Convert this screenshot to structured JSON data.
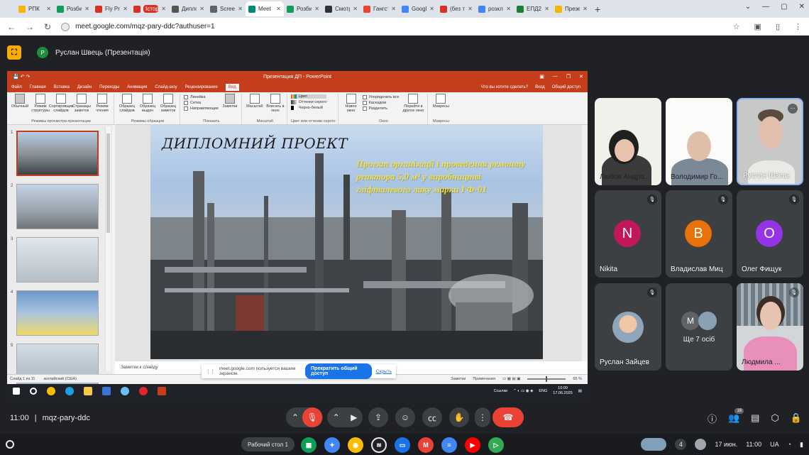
{
  "browser": {
    "tabs": [
      {
        "label": "РПК",
        "color": "#f4b400",
        "pill": false
      },
      {
        "label": "Розбив",
        "color": "#0f9d58"
      },
      {
        "label": "Fly Proje",
        "color": "#d93025"
      },
      {
        "label": "Історія",
        "color": "#d93025",
        "pill": true
      },
      {
        "label": "Диплом",
        "color": "#555555"
      },
      {
        "label": "Screensh",
        "color": "#5f6368"
      },
      {
        "label": "Meet",
        "color": "#00897b",
        "active": true
      },
      {
        "label": "Розбив",
        "color": "#0f9d58"
      },
      {
        "label": "Смотрет",
        "color": "#333333"
      },
      {
        "label": "Гангстер",
        "color": "#ea4335"
      },
      {
        "label": "Google G",
        "color": "#4285f4"
      },
      {
        "label": "(без тем",
        "color": "#d93025"
      },
      {
        "label": "розклад",
        "color": "#4285f4"
      },
      {
        "label": "ЕПД23 н",
        "color": "#188038"
      },
      {
        "label": "Презент",
        "color": "#f4b400"
      }
    ],
    "url": "meet.google.com/mqz-pary-ddc?authuser=1"
  },
  "meet": {
    "presenter_initial": "P",
    "presenter_title": "Руслан Швець (Презентація)",
    "meeting_time": "11:00",
    "meeting_code": "mqz-pary-ddc",
    "participant_count_badge": "16"
  },
  "ppt": {
    "window_title": "Презентация ДП - PowerPoint",
    "ribbon_tabs": [
      "Файл",
      "Главная",
      "Вставка",
      "Дизайн",
      "Переходы",
      "Анимация",
      "Слайд-шоу",
      "Рецензирование",
      "Вид"
    ],
    "tell_me": "Что вы хотите сделать?",
    "signin": "Вход",
    "share": "Общий доступ",
    "groups": {
      "views": {
        "label": "Режимы просмотра презентации",
        "buttons": [
          "Обычный",
          "Режим структуры",
          "Сортировщик слайдов",
          "Страницы заметок",
          "Режим чтения"
        ]
      },
      "masters": {
        "label": "Режимы образцов",
        "buttons": [
          "Образец слайдов",
          "Образец выдач",
          "Образец заметок"
        ]
      },
      "show": {
        "label": "Показать",
        "checks": [
          "Линейка",
          "Сетка",
          "Направляющие"
        ],
        "notes_button": "Заметки"
      },
      "zoom": {
        "label": "Масштаб",
        "buttons": [
          "Масштаб",
          "Вписать в окно"
        ]
      },
      "color": {
        "label": "Цвет или оттенки серого",
        "options": [
          "Цвет",
          "Оттенки серого",
          "Черно-белый"
        ]
      },
      "window": {
        "label": "Окно",
        "new_window": "Новое окно",
        "items": [
          "Упорядочить все",
          "Каскадом",
          "Разделить"
        ],
        "switch": "Перейти в другое окно"
      },
      "macros": {
        "label": "Макросы",
        "button": "Макросы"
      }
    },
    "slide": {
      "title": "ДИПЛОМНИЙ ПРОЕКТ",
      "subtitle": "Проект організації і проведення ремонту реактора 5,0 м³ у виробництві гліфталевого лаку марки ГФ-01"
    },
    "thumb_numbers": [
      "1",
      "2",
      "3",
      "4",
      "5"
    ],
    "notes_placeholder": "Заметки к слайду",
    "status": {
      "slide": "Слайд 1 из 11",
      "lang": "английский (США)",
      "notes": "Заметки",
      "comments": "Примечания",
      "zoom": "65 %"
    },
    "taskbar": {
      "links": "Ссылки",
      "lang": "ENG",
      "time": "10:00",
      "date": "17.06.2025"
    }
  },
  "share_banner": {
    "text": "meet.google.com пользуется вашим экраном.",
    "stop": "Прекратить общий доступ",
    "hide": "Скрыть"
  },
  "participants": [
    {
      "name": "Любов Андро...",
      "type": "photo"
    },
    {
      "name": "Володимир Го...",
      "type": "photo"
    },
    {
      "name": "Руслан Швець",
      "type": "photo",
      "active": true
    },
    {
      "name": "Nikita",
      "initial": "N",
      "color": "#c2185b",
      "bg": "#3c4043"
    },
    {
      "name": "Владислав Миц",
      "initial": "В",
      "color": "#e8710a",
      "bg": "#3c4043"
    },
    {
      "name": "Олег Фищук",
      "initial": "О",
      "color": "#9334e6",
      "bg": "#3c4043"
    },
    {
      "name": "Руслан Зайцев",
      "type": "avatar-photo"
    },
    {
      "more_label": "Ще 7 осіб",
      "initial": "М"
    },
    {
      "name": "Людмила ...",
      "type": "photo"
    }
  ],
  "shelf": {
    "desk": "Рабочий стол 1",
    "notif": "4",
    "date": "17 июн.",
    "time": "11:00",
    "region": "UA"
  }
}
